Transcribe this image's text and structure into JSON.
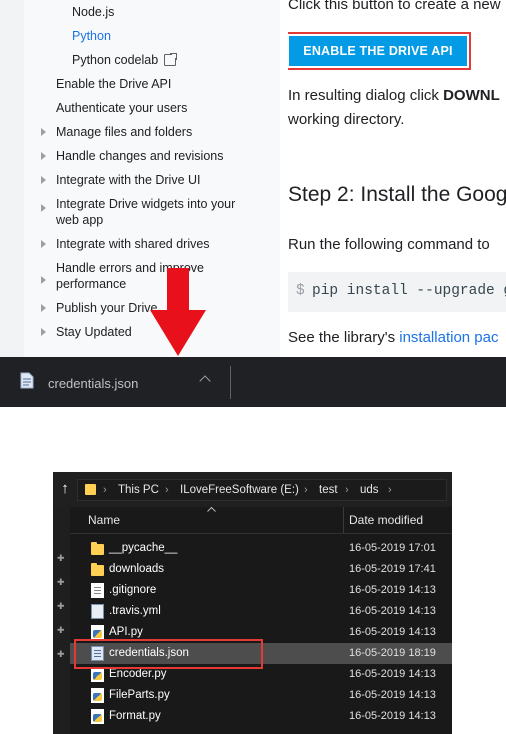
{
  "docs": {
    "sidebar": {
      "items": [
        {
          "label": "Node.js"
        },
        {
          "label": "Python"
        },
        {
          "label": "Python codelab"
        },
        {
          "label": "Enable the Drive API"
        },
        {
          "label": "Authenticate your users"
        },
        {
          "label": "Manage files and folders"
        },
        {
          "label": "Handle changes and revisions"
        },
        {
          "label": "Integrate with the Drive UI"
        },
        {
          "label": "Integrate Drive widgets into your"
        },
        {
          "label": "web app"
        },
        {
          "label": "Integrate with shared drives"
        },
        {
          "label": "Handle errors and improve"
        },
        {
          "label": "performance"
        },
        {
          "label": "Publish your Drive"
        },
        {
          "label": "Stay Updated"
        }
      ]
    },
    "content": {
      "intro": "Click this button to create a new",
      "enable_button": "ENABLE THE DRIVE API",
      "dialog_text_1": "In resulting dialog click ",
      "dialog_text_bold": "DOWNL",
      "dialog_text_2": "working directory.",
      "step_heading": "Step 2: Install the Goog",
      "run_text": "Run the following command to",
      "code_prompt": "$",
      "code_cmd": "pip install --upgrade g",
      "see_text": "See the library's ",
      "see_link": "installation pac"
    }
  },
  "download_bar": {
    "filename": "credentials.json"
  },
  "explorer": {
    "breadcrumb": [
      "This PC",
      "ILoveFreeSoftware (E:)",
      "test",
      "uds"
    ],
    "columns": {
      "name": "Name",
      "date": "Date modified"
    },
    "files": [
      {
        "name": "__pycache__",
        "date": "16-05-2019 17:01",
        "type": "folder"
      },
      {
        "name": "downloads",
        "date": "16-05-2019 17:41",
        "type": "folder"
      },
      {
        "name": ".gitignore",
        "date": "16-05-2019 14:13",
        "type": "doc"
      },
      {
        "name": ".travis.yml",
        "date": "16-05-2019 14:13",
        "type": "yml"
      },
      {
        "name": "API.py",
        "date": "16-05-2019 14:13",
        "type": "py"
      },
      {
        "name": "credentials.json",
        "date": "16-05-2019 18:19",
        "type": "json"
      },
      {
        "name": "Encoder.py",
        "date": "16-05-2019 14:13",
        "type": "py"
      },
      {
        "name": "FileParts.py",
        "date": "16-05-2019 14:13",
        "type": "py"
      },
      {
        "name": "Format.py",
        "date": "16-05-2019 14:13",
        "type": "py"
      }
    ]
  },
  "colors": {
    "accent_blue": "#039be5",
    "highlight_red": "#e53935",
    "link_blue": "#1a73e8"
  }
}
